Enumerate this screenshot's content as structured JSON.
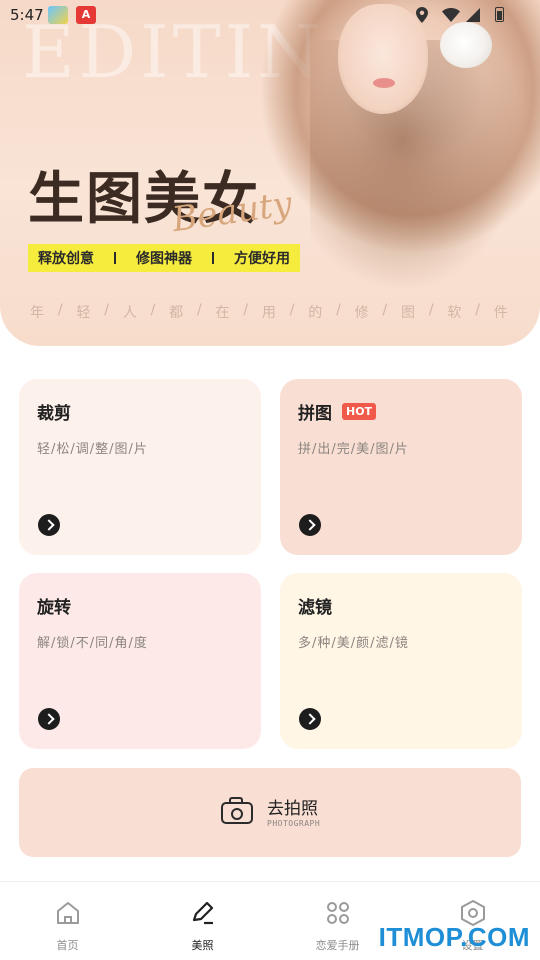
{
  "status_bar": {
    "time": "5:47",
    "app2_label": "A"
  },
  "hero": {
    "bg_word": "EDITIN",
    "title": "生图美女",
    "script_word": "Beauty",
    "tags": [
      "释放创意",
      "修图神器",
      "方便好用"
    ],
    "subtitle_chars": [
      "年",
      "轻",
      "人",
      "都",
      "在",
      "用",
      "的",
      "修",
      "图",
      "软",
      "件"
    ]
  },
  "cards": {
    "crop": {
      "title": "裁剪",
      "desc": "轻/松/调/整/图/片"
    },
    "collage": {
      "title": "拼图",
      "badge": "HOT",
      "desc": "拼/出/完/美/图/片"
    },
    "rotate": {
      "title": "旋转",
      "desc": "解/锁/不/同/角/度"
    },
    "filter": {
      "title": "滤镜",
      "desc": "多/种/美/颜/滤/镜"
    }
  },
  "photo_button": {
    "label": "去拍照",
    "sub": "PHOTOGRAPH"
  },
  "nav": {
    "items": [
      {
        "label": "首页",
        "icon": "home-icon"
      },
      {
        "label": "美照",
        "icon": "edit-pen-icon"
      },
      {
        "label": "恋爱手册",
        "icon": "grid-icon"
      },
      {
        "label": "设置",
        "icon": "settings-hex-icon"
      }
    ],
    "active_index": 1
  },
  "watermark": "ITMOP.COM"
}
